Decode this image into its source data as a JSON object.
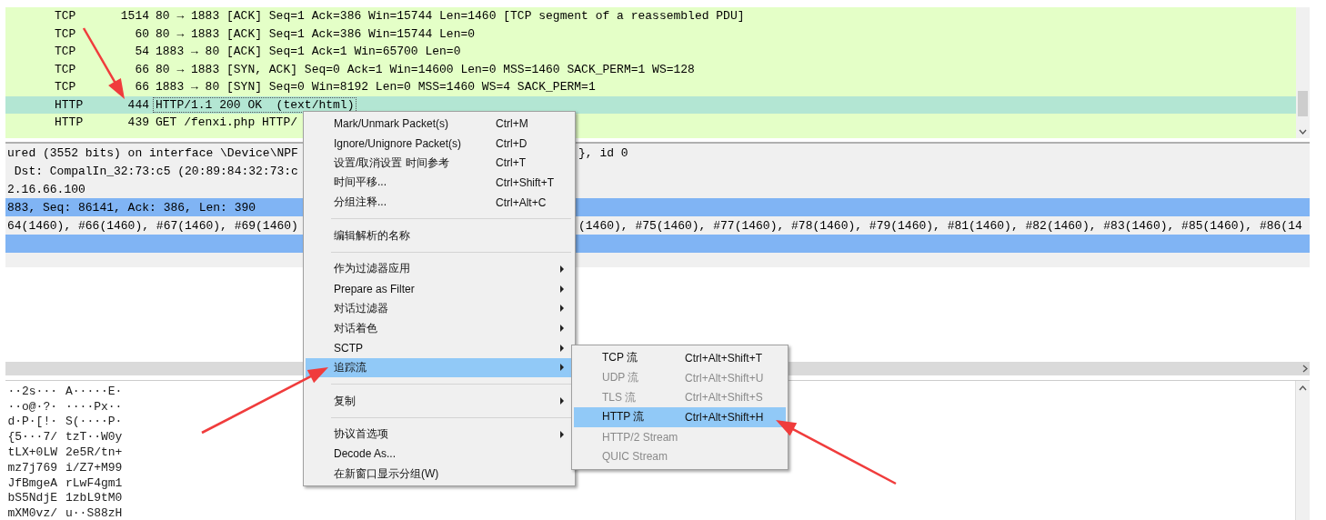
{
  "packet_list": {
    "rows": [
      {
        "protocol": "TCP",
        "length": "1514",
        "info": "80 → 1883 [ACK] Seq=1 Ack=386 Win=15744 Len=1460 [TCP segment of a reassembled PDU]",
        "selected": false
      },
      {
        "protocol": "TCP",
        "length": "60",
        "info": "80 → 1883 [ACK] Seq=1 Ack=386 Win=15744 Len=0",
        "selected": false
      },
      {
        "protocol": "TCP",
        "length": "54",
        "info": "1883 → 80 [ACK] Seq=1 Ack=1 Win=65700 Len=0",
        "selected": false
      },
      {
        "protocol": "TCP",
        "length": "66",
        "info": "80 → 1883 [SYN, ACK] Seq=0 Ack=1 Win=14600 Len=0 MSS=1460 SACK_PERM=1 WS=128",
        "selected": false
      },
      {
        "protocol": "TCP",
        "length": "66",
        "info": "1883 → 80 [SYN] Seq=0 Win=8192 Len=0 MSS=1460 WS=4 SACK_PERM=1",
        "selected": false
      },
      {
        "protocol": "HTTP",
        "length": "444",
        "info": "HTTP/1.1 200 OK  (text/html)",
        "selected": true
      },
      {
        "protocol": "HTTP",
        "length": "439",
        "info": "GET /fenxi.php HTTP/",
        "selected": false
      }
    ]
  },
  "details": {
    "lines": [
      {
        "text": "ured (3552 bits) on interface \\Device\\NPF",
        "text_right": "}, id 0",
        "selected": false
      },
      {
        "text": " Dst: CompalIn_32:73:c5 (20:89:84:32:73:c",
        "selected": false
      },
      {
        "text": "2.16.66.100",
        "selected": false
      },
      {
        "text": "883, Seq: 86141, Ack: 386, Len: 390",
        "selected": true
      },
      {
        "text": "64(1460), #66(1460), #67(1460), #69(1460)",
        "text_right": "(1460), #75(1460), #77(1460), #78(1460), #79(1460), #81(1460), #82(1460), #83(1460), #85(1460), #86(14",
        "selected": false
      },
      {
        "selected": true
      }
    ]
  },
  "bytes": {
    "lines": [
      {
        "col_1": "··2s···",
        "col_2": "A·····E·"
      },
      {
        "col_1": "··o@·?·",
        "col_2": "····Px··"
      },
      {
        "col_1": "d·P·[!·",
        "col_2": "S(····P·"
      },
      {
        "col_1": "{5···7/",
        "col_2": "tzT··W0y"
      },
      {
        "col_1": "tLX+0LW",
        "col_2": "2e5R/tn+"
      },
      {
        "col_1": "mz7j769",
        "col_2": "i/Z7+M99"
      },
      {
        "col_1": "JfBmgeA",
        "col_2": "rLwF4gm1"
      },
      {
        "col_1": "bS5NdjE",
        "col_2": "1zbL9tM0"
      },
      {
        "col_1": "mXM0vz/",
        "col_2": "u··S88zH"
      }
    ]
  },
  "context_menu": {
    "items": [
      {
        "kind": "item",
        "label": "Mark/Unmark Packet(s)",
        "shortcut": "Ctrl+M",
        "has_submenu": false,
        "selected": false
      },
      {
        "kind": "item",
        "label": "Ignore/Unignore Packet(s)",
        "shortcut": "Ctrl+D",
        "has_submenu": false,
        "selected": false
      },
      {
        "kind": "item",
        "label": "设置/取消设置 时间参考",
        "shortcut": "Ctrl+T",
        "has_submenu": false,
        "selected": false
      },
      {
        "kind": "item",
        "label": "时间平移...",
        "shortcut": "Ctrl+Shift+T",
        "has_submenu": false,
        "selected": false
      },
      {
        "kind": "item",
        "label": "分组注释...",
        "shortcut": "Ctrl+Alt+C",
        "has_submenu": false,
        "selected": false
      },
      {
        "kind": "separator"
      },
      {
        "kind": "item",
        "label": "编辑解析的名称",
        "has_submenu": false,
        "selected": false
      },
      {
        "kind": "separator"
      },
      {
        "kind": "item",
        "label": "作为过滤器应用",
        "has_submenu": true,
        "selected": false
      },
      {
        "kind": "item",
        "label": "Prepare as Filter",
        "has_submenu": true,
        "selected": false
      },
      {
        "kind": "item",
        "label": "对话过滤器",
        "has_submenu": true,
        "selected": false
      },
      {
        "kind": "item",
        "label": "对话着色",
        "has_submenu": true,
        "selected": false
      },
      {
        "kind": "item",
        "label": "SCTP",
        "has_submenu": true,
        "selected": false
      },
      {
        "kind": "item",
        "label": "追踪流",
        "has_submenu": true,
        "selected": true
      },
      {
        "kind": "separator"
      },
      {
        "kind": "item",
        "label": "复制",
        "has_submenu": true,
        "selected": false
      },
      {
        "kind": "separator"
      },
      {
        "kind": "item",
        "label": "协议首选项",
        "has_submenu": true,
        "selected": false
      },
      {
        "kind": "item",
        "label": "Decode As...",
        "has_submenu": false,
        "selected": false
      },
      {
        "kind": "item",
        "label": "在新窗口显示分组(W)",
        "has_submenu": false,
        "selected": false
      }
    ]
  },
  "submenu": {
    "items": [
      {
        "label": "TCP 流",
        "shortcut": "Ctrl+Alt+Shift+T",
        "disabled": false,
        "selected": false
      },
      {
        "label": "UDP 流",
        "shortcut": "Ctrl+Alt+Shift+U",
        "disabled": true,
        "selected": false
      },
      {
        "label": "TLS 流",
        "shortcut": "Ctrl+Alt+Shift+S",
        "disabled": true,
        "selected": false
      },
      {
        "label": "HTTP 流",
        "shortcut": "Ctrl+Alt+Shift+H",
        "disabled": false,
        "selected": true
      },
      {
        "label": "HTTP/2 Stream",
        "disabled": true,
        "selected": false
      },
      {
        "label": "QUIC Stream",
        "disabled": true,
        "selected": false
      }
    ]
  }
}
